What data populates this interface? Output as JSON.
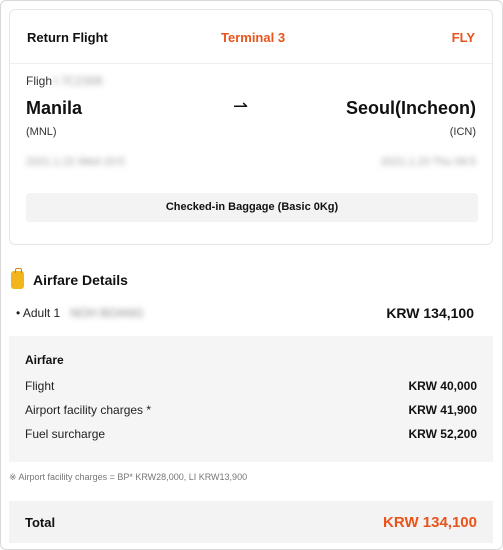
{
  "flight_card": {
    "header": {
      "title": "Return Flight",
      "terminal": "Terminal 3",
      "airline_tag": "FLY"
    },
    "flight_label": "Fligh",
    "flight_number_blurred": "t 7C2306",
    "departure": {
      "city": "Manila",
      "code": "(MNL)",
      "datetime_blurred": "2021.1.22 Wed 20:5"
    },
    "arrow": "⇀",
    "arrival": {
      "city": "Seoul(Incheon)",
      "code": "(ICN)",
      "datetime_blurred": "2021.1.23 Thu 06:5"
    },
    "baggage": "Checked-in Baggage (Basic 0Kg)"
  },
  "airfare": {
    "section_title": "Airfare Details",
    "passenger": {
      "label": "• Adult 1",
      "name_blurred": "NOH BOANG",
      "price": "KRW 134,100"
    },
    "breakdown": {
      "title": "Airfare",
      "rows": [
        {
          "label": "Flight",
          "value": "KRW 40,000"
        },
        {
          "label": "Airport facility charges *",
          "value": "KRW 41,900"
        },
        {
          "label": "Fuel surcharge",
          "value": "KRW 52,200"
        }
      ]
    },
    "note": "※ Airport facility charges = BP* KRW28,000, LI KRW13,900"
  },
  "total": {
    "label": "Total",
    "value": "KRW 134,100"
  },
  "colors": {
    "accent": "#e8541c",
    "panel": "#f5f5f5",
    "icon": "#f2b51c"
  }
}
